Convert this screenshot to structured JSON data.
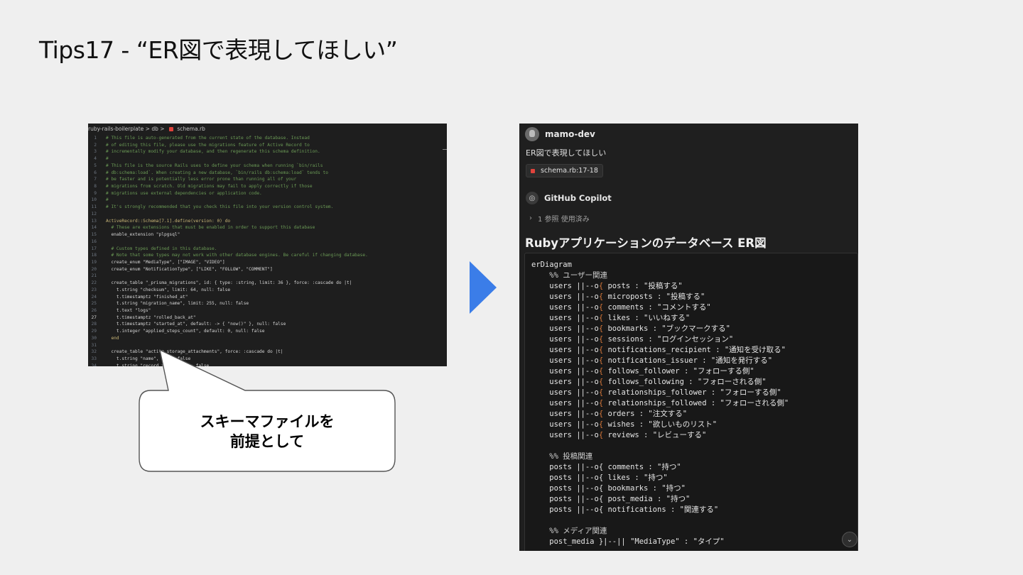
{
  "slide": {
    "title": "Tips17 - “ER図で表現してほしい”"
  },
  "editor": {
    "breadcrumb": {
      "project": "ruby-rails-boilerplate",
      "folder": "db",
      "file": "schema.rb"
    },
    "lines": [
      {
        "n": "1",
        "t": "# This file is auto-generated from the current state of the database. Instead",
        "k": "comment"
      },
      {
        "n": "2",
        "t": "# of editing this file, please use the migrations feature of Active Record to",
        "k": "comment"
      },
      {
        "n": "3",
        "t": "# incrementally modify your database, and then regenerate this schema definition.",
        "k": "comment"
      },
      {
        "n": "4",
        "t": "#",
        "k": "comment"
      },
      {
        "n": "5",
        "t": "# This file is the source Rails uses to define your schema when running `bin/rails",
        "k": "comment"
      },
      {
        "n": "6",
        "t": "# db:schema:load`. When creating a new database, `bin/rails db:schema:load` tends to",
        "k": "comment"
      },
      {
        "n": "7",
        "t": "# be faster and is potentially less error prone than running all of your",
        "k": "comment"
      },
      {
        "n": "8",
        "t": "# migrations from scratch. Old migrations may fail to apply correctly if those",
        "k": "comment"
      },
      {
        "n": "9",
        "t": "# migrations use external dependencies or application code.",
        "k": "comment"
      },
      {
        "n": "10",
        "t": "#",
        "k": "comment"
      },
      {
        "n": "11",
        "t": "# It's strongly recommended that you check this file into your version control system.",
        "k": "comment"
      },
      {
        "n": "12",
        "t": "",
        "k": "plain"
      },
      {
        "n": "13",
        "t": "ActiveRecord::Schema[7.1].define(version: 0) do",
        "k": "key"
      },
      {
        "n": "14",
        "t": "  # These are extensions that must be enabled in order to support this database",
        "k": "comment"
      },
      {
        "n": "15",
        "t": "  enable_extension \"plpgsql\"",
        "k": "plain"
      },
      {
        "n": "16",
        "t": "",
        "k": "plain"
      },
      {
        "n": "17",
        "t": "  # Custom types defined in this database.",
        "k": "comment"
      },
      {
        "n": "18",
        "t": "  # Note that some types may not work with other database engines. Be careful if changing database.",
        "k": "comment"
      },
      {
        "n": "19",
        "t": "  create_enum \"MediaType\", [\"IMAGE\", \"VIDEO\"]",
        "k": "plain"
      },
      {
        "n": "20",
        "t": "  create_enum \"NotificationType\", [\"LIKE\", \"FOLLOW\", \"COMMENT\"]",
        "k": "plain"
      },
      {
        "n": "21",
        "t": "",
        "k": "plain"
      },
      {
        "n": "22",
        "t": "  create_table \"_prisma_migrations\", id: { type: :string, limit: 36 }, force: :cascade do |t|",
        "k": "plain"
      },
      {
        "n": "23",
        "t": "    t.string \"checksum\", limit: 64, null: false",
        "k": "plain"
      },
      {
        "n": "24",
        "t": "    t.timestamptz \"finished_at\"",
        "k": "plain"
      },
      {
        "n": "25",
        "t": "    t.string \"migration_name\", limit: 255, null: false",
        "k": "plain"
      },
      {
        "n": "26",
        "t": "    t.text \"logs\"",
        "k": "plain"
      },
      {
        "n": "27",
        "t": "    t.timestamptz \"rolled_back_at\"",
        "k": "plain",
        "cur": true
      },
      {
        "n": "28",
        "t": "    t.timestamptz \"started_at\", default: -> { \"now()\" }, null: false",
        "k": "plain"
      },
      {
        "n": "29",
        "t": "    t.integer \"applied_steps_count\", default: 0, null: false",
        "k": "plain"
      },
      {
        "n": "30",
        "t": "  end",
        "k": "key"
      },
      {
        "n": "31",
        "t": "",
        "k": "plain"
      },
      {
        "n": "32",
        "t": "  create_table \"active_storage_attachments\", force: :cascade do |t|",
        "k": "plain"
      },
      {
        "n": "33",
        "t": "    t.string \"name\", null: false",
        "k": "plain"
      },
      {
        "n": "34",
        "t": "    t.string \"record_type\", null: false",
        "k": "plain"
      }
    ]
  },
  "callout": {
    "line1": "スキーマファイルを",
    "line2": "前提として"
  },
  "chat": {
    "user": {
      "name": "mamo-dev",
      "prompt": "ER図で表現してほしい"
    },
    "reference_chip": "schema.rb:17-18",
    "assistant": {
      "name": "GitHub Copilot",
      "refs_label": "1 参照 使用済み"
    },
    "answer_title": "Rubyアプリケーションのデータベース ER図",
    "mermaid_lines": [
      {
        "pre": "erDiagram",
        "post": "",
        "paren": false
      },
      {
        "pre": "    %% ユーザー関連",
        "post": "",
        "paren": false,
        "section": true
      },
      {
        "pre": "    users ||--o",
        "post": " posts : \"投稿する\"",
        "paren": true
      },
      {
        "pre": "    users ||--o",
        "post": " microposts : \"投稿する\"",
        "paren": true
      },
      {
        "pre": "    users ||--o",
        "post": " comments : \"コメントする\"",
        "paren": true
      },
      {
        "pre": "    users ||--o",
        "post": " likes : \"いいねする\"",
        "paren": true
      },
      {
        "pre": "    users ||--o",
        "post": " bookmarks : \"ブックマークする\"",
        "paren": true
      },
      {
        "pre": "    users ||--o",
        "post": " sessions : \"ログインセッション\"",
        "paren": true
      },
      {
        "pre": "    users ||--o",
        "post": " notifications_recipient : \"通知を受け取る\"",
        "paren": true
      },
      {
        "pre": "    users ||--o",
        "post": " notifications_issuer : \"通知を発行する\"",
        "paren": true
      },
      {
        "pre": "    users ||--o",
        "post": " follows_follower : \"フォローする側\"",
        "paren": true
      },
      {
        "pre": "    users ||--o",
        "post": " follows_following : \"フォローされる側\"",
        "paren": true
      },
      {
        "pre": "    users ||--o",
        "post": " relationships_follower : \"フォローする側\"",
        "paren": true
      },
      {
        "pre": "    users ||--o",
        "post": " relationships_followed : \"フォローされる側\"",
        "paren": true
      },
      {
        "pre": "    users ||--o",
        "post": " orders : \"注文する\"",
        "paren": true
      },
      {
        "pre": "    users ||--o",
        "post": " wishes : \"欲しいものリスト\"",
        "paren": true
      },
      {
        "pre": "    users ||--o",
        "post": " reviews : \"レビューする\"",
        "paren": true
      },
      {
        "pre": "",
        "post": "",
        "paren": false
      },
      {
        "pre": "    %% 投稿関連",
        "post": "",
        "paren": false,
        "section": true
      },
      {
        "pre": "    posts ||--o{ comments : \"持つ\"",
        "post": "",
        "paren": false
      },
      {
        "pre": "    posts ||--o{ likes : \"持つ\"",
        "post": "",
        "paren": false
      },
      {
        "pre": "    posts ||--o{ bookmarks : \"持つ\"",
        "post": "",
        "paren": false
      },
      {
        "pre": "    posts ||--o{ post_media : \"持つ\"",
        "post": "",
        "paren": false
      },
      {
        "pre": "    posts ||--o{ notifications : \"関連する\"",
        "post": "",
        "paren": false
      },
      {
        "pre": "",
        "post": "",
        "paren": false
      },
      {
        "pre": "    %% メディア関連",
        "post": "",
        "paren": false,
        "section": true
      },
      {
        "pre": "    post_media }|--|| \"MediaType\" : \"タイプ\"",
        "post": "",
        "paren": false
      }
    ]
  },
  "icons": {
    "arrow": "play-arrow-icon",
    "copilot": "copilot-icon",
    "scroll": "chevron-down-icon"
  },
  "colors": {
    "arrow": "#3b7de8",
    "ruby": "#e0433c",
    "paren": "#d9783a"
  }
}
